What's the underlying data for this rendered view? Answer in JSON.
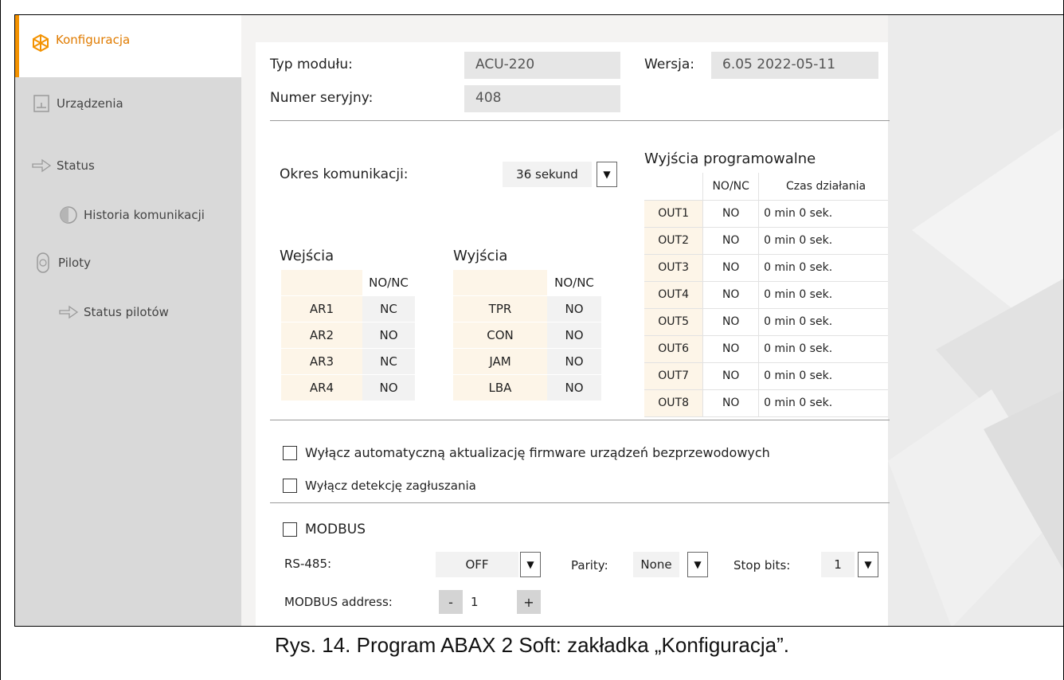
{
  "sidebar": {
    "items": [
      {
        "label": "Konfiguracja",
        "icon": "config-icon",
        "active": true
      },
      {
        "label": "Urządzenia",
        "icon": "device-icon"
      },
      {
        "label": "Status",
        "icon": "status-arrows-icon"
      },
      {
        "label": "Historia komunikacji",
        "icon": "history-clock-icon"
      },
      {
        "label": "Piloty",
        "icon": "remote-icon"
      },
      {
        "label": "Status pilotów",
        "icon": "status-arrows-icon"
      }
    ]
  },
  "module": {
    "type_label": "Typ modułu:",
    "type_value": "ACU-220",
    "version_label": "Wersja:",
    "version_value": "6.05 2022-05-11",
    "serial_label": "Numer seryjny:",
    "serial_value": "408"
  },
  "comm": {
    "label": "Okres komunikacji:",
    "value": "36 sekund"
  },
  "inputs": {
    "title": "Wejścia",
    "header": "NO/NC",
    "rows": [
      {
        "name": "AR1",
        "value": "NC"
      },
      {
        "name": "AR2",
        "value": "NO"
      },
      {
        "name": "AR3",
        "value": "NC"
      },
      {
        "name": "AR4",
        "value": "NO"
      }
    ]
  },
  "outputs": {
    "title": "Wyjścia",
    "header": "NO/NC",
    "rows": [
      {
        "name": "TPR",
        "value": "NO"
      },
      {
        "name": "CON",
        "value": "NO"
      },
      {
        "name": "JAM",
        "value": "NO"
      },
      {
        "name": "LBA",
        "value": "NO"
      }
    ]
  },
  "prog_outputs": {
    "title": "Wyjścia programowalne",
    "header_nonc": "NO/NC",
    "header_time": "Czas działania",
    "rows": [
      {
        "name": "OUT1",
        "nonc": "NO",
        "time": "0 min 0 sek."
      },
      {
        "name": "OUT2",
        "nonc": "NO",
        "time": "0 min 0 sek."
      },
      {
        "name": "OUT3",
        "nonc": "NO",
        "time": "0 min 0 sek."
      },
      {
        "name": "OUT4",
        "nonc": "NO",
        "time": "0 min 0 sek."
      },
      {
        "name": "OUT5",
        "nonc": "NO",
        "time": "0 min 0 sek."
      },
      {
        "name": "OUT6",
        "nonc": "NO",
        "time": "0 min 0 sek."
      },
      {
        "name": "OUT7",
        "nonc": "NO",
        "time": "0 min 0 sek."
      },
      {
        "name": "OUT8",
        "nonc": "NO",
        "time": "0 min 0 sek."
      }
    ]
  },
  "options": {
    "disable_fw_update": "Wyłącz automatyczną aktualizację firmware urządzeń bezprzewodowych",
    "disable_jamming": "Wyłącz detekcję zagłuszania"
  },
  "modbus": {
    "checkbox_label": "MODBUS",
    "rs485_label": "RS-485:",
    "rs485_value": "OFF",
    "parity_label": "Parity:",
    "parity_value": "None",
    "stopbits_label": "Stop bits:",
    "stopbits_value": "1",
    "address_label": "MODBUS address:",
    "address_value": "1",
    "minus": "-",
    "plus": "+"
  },
  "caption": "Rys. 14. Program ABAX 2 Soft: zakładka „Konfiguracja”.",
  "colors": {
    "accent": "#f39200",
    "sidebar_bg": "#d9d9d9",
    "field_bg": "#e6e6e6",
    "row_label_bg": "#fdf5e8"
  }
}
